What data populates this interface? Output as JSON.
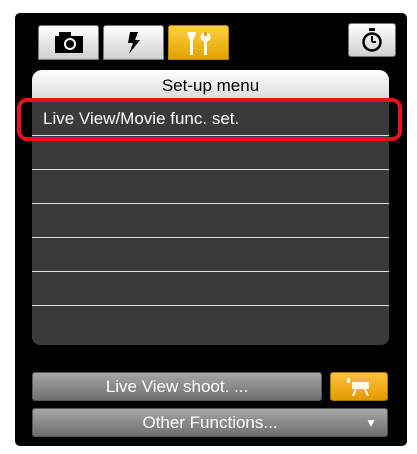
{
  "tabs": [
    {
      "icon": "camera-icon",
      "active": false
    },
    {
      "icon": "flash-icon",
      "active": false
    },
    {
      "icon": "setup-tools-icon",
      "active": true
    }
  ],
  "timer_button": {
    "icon": "stopwatch-icon"
  },
  "menu": {
    "title": "Set-up menu",
    "items": [
      "Live View/Movie func. set.",
      "",
      "",
      "",
      "",
      "",
      ""
    ]
  },
  "buttons": {
    "live_view_shoot": "Live View shoot. ...",
    "video_icon": "movie-camera-icon",
    "other_functions": "Other Functions...",
    "other_functions_arrow": "▼"
  },
  "colors": {
    "active_tab": "#f2b400",
    "highlight": "#e8121b",
    "video_button": "#f2a800"
  }
}
